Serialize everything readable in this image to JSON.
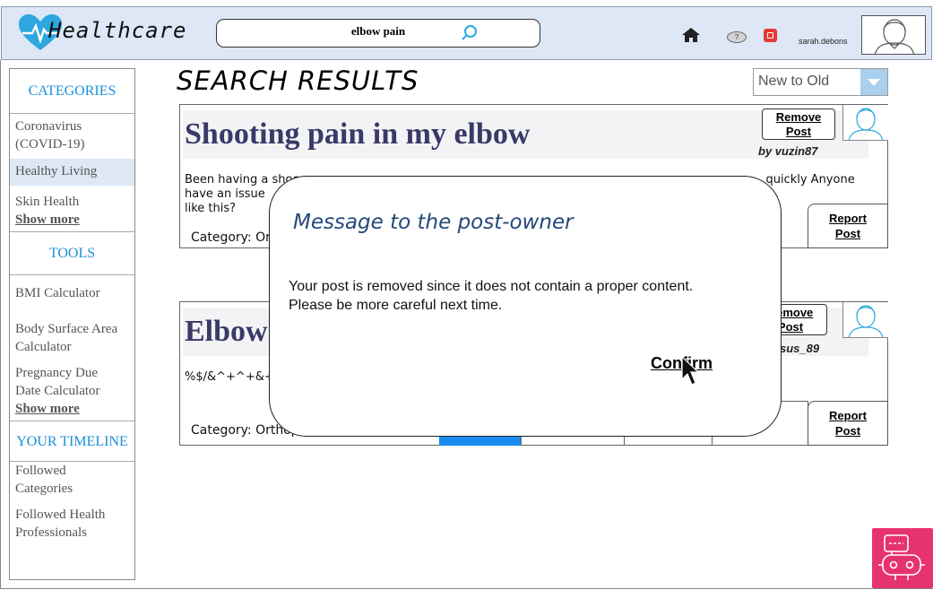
{
  "header": {
    "logo_text": "Healthcare",
    "search_value": "elbow pain",
    "username": "sarah.debons",
    "help_glyph": "?"
  },
  "sidebar": {
    "categories_heading": "CATEGORIES",
    "categories": [
      "Coronavirus (COVID-19)",
      "Healthy Living",
      "Skin Health"
    ],
    "categories_show_more": "Show more",
    "tools_heading": "TOOLS",
    "tools": [
      "BMI Calculator",
      "Body Surface Area Calculator",
      "Pregnancy Due Date Calculator"
    ],
    "tools_show_more": "Show more",
    "timeline_heading": "YOUR TIMELINE",
    "timeline": [
      "Followed Categories",
      "Followed Health Professionals"
    ]
  },
  "main": {
    "title": "SEARCH RESULTS",
    "sort_value": "New to Old",
    "posts": [
      {
        "title": "Shooting pain in my elbow",
        "remove_label_1": "Remove",
        "remove_label_2": "Post",
        "author": "by vuzin87",
        "body_line1": "Been having a shoo",
        "body_line1_end": "quickly Anyone",
        "body_line2": "have an issue",
        "body_line3": "like this?",
        "category": "Category: Ort",
        "report_label_1": "Report",
        "report_label_2": "Post"
      },
      {
        "title": "Elbow",
        "remove_label_1": "Remove",
        "remove_label_2": "Post",
        "author": "sus_89",
        "body_line1": "%$/&^+^+&+%",
        "category": "Category: Orthop",
        "report_label_1": "Report",
        "report_label_2": "Post"
      }
    ]
  },
  "modal": {
    "title": "Message to the post-owner",
    "message_line1": "Your post is removed since it does not contain a proper content.",
    "message_line2": "Please be more careful next time.",
    "confirm_label": "Confirm"
  },
  "colors": {
    "accent": "#1a8fd8",
    "header_bg": "#dde7f6",
    "chatbot": "#e6336e",
    "title_text": "#3a3a68"
  }
}
